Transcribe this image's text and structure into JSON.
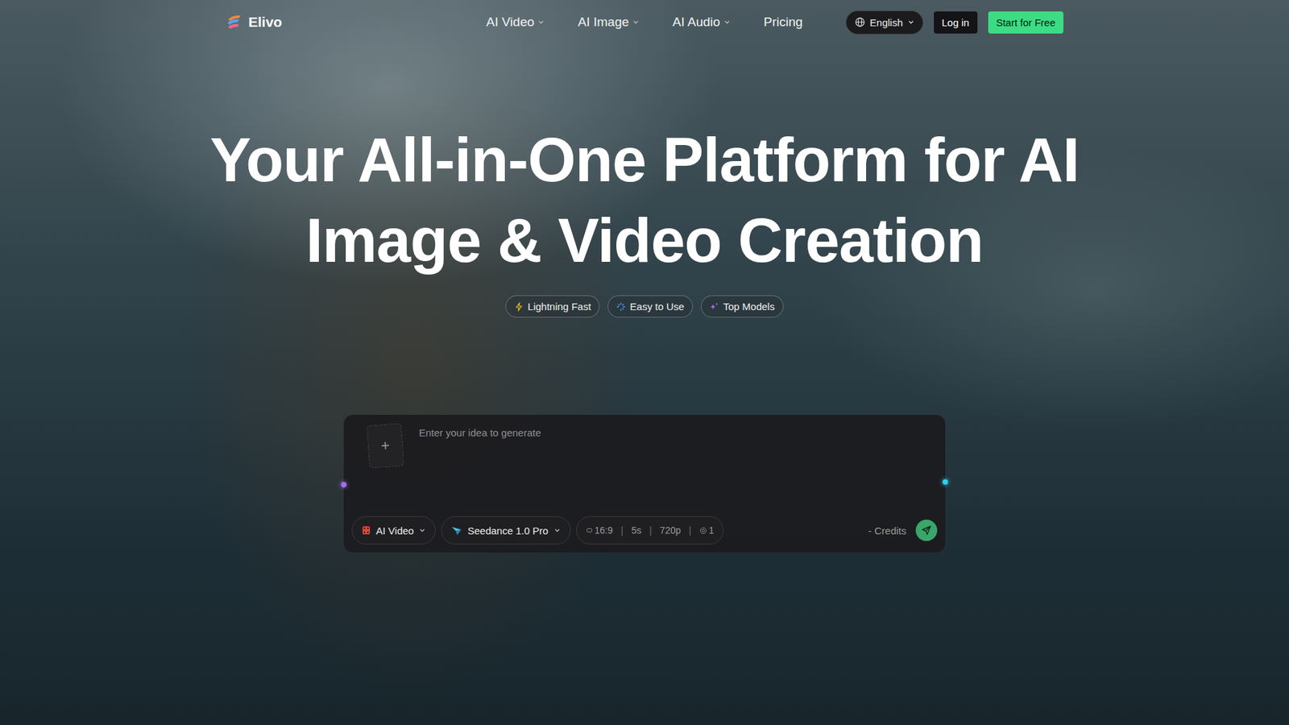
{
  "nav": {
    "logo": "Elivo",
    "links": [
      {
        "label": "AI Video",
        "dropdown": true
      },
      {
        "label": "AI Image",
        "dropdown": true
      },
      {
        "label": "AI Audio",
        "dropdown": true
      },
      {
        "label": "Pricing",
        "dropdown": false
      }
    ],
    "language": "English",
    "login": "Log in",
    "cta": "Start for Free"
  },
  "hero": {
    "title_lines": [
      "Your All-in-One Platform for AI",
      "Image & Video Creation"
    ],
    "badges": [
      {
        "label": "Lightning Fast",
        "color": "#f5c518"
      },
      {
        "label": "Easy to Use",
        "color": "#4aa3ff"
      },
      {
        "label": "Top Models",
        "color": "#b46cff"
      }
    ]
  },
  "prompt": {
    "upload_icon": "+",
    "placeholder": "Enter your idea to generate",
    "mode": "AI Video",
    "model": "Seedance 1.0 Pro",
    "separator": "|",
    "params": [
      {
        "label": "16:9",
        "kind": "ratio"
      },
      {
        "label": "5s",
        "kind": "plain"
      },
      {
        "label": "720p",
        "kind": "plain"
      },
      {
        "label": "1",
        "kind": "count"
      }
    ],
    "credits": "- Credits"
  }
}
